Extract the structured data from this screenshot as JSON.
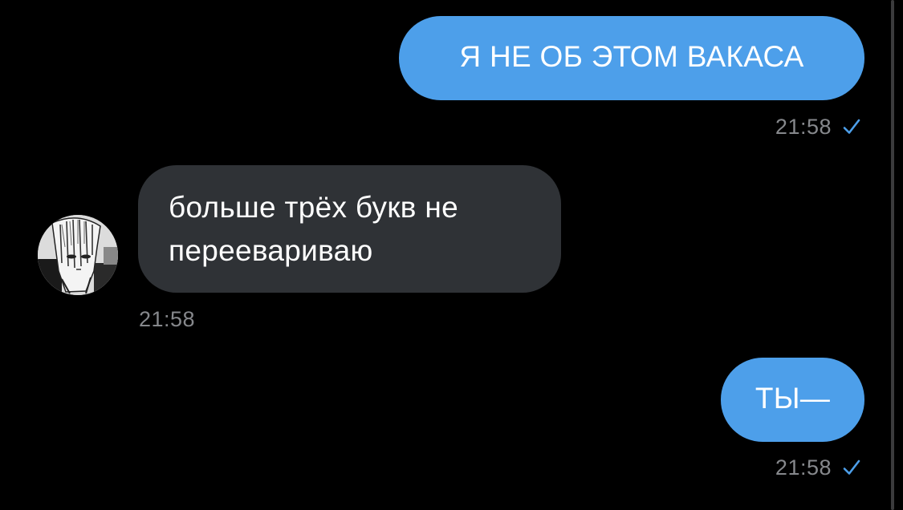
{
  "messages": [
    {
      "direction": "outgoing",
      "text": "Я НЕ ОБ ЭТОМ ВАКАСА",
      "time": "21:58",
      "status_icon": "single-check-icon"
    },
    {
      "direction": "incoming",
      "text": "больше трёх букв не\nпереевариваю",
      "time": "21:58",
      "avatar_icon": "avatar-manga-character"
    },
    {
      "direction": "outgoing",
      "text": "ТЫ—",
      "time": "21:58",
      "status_icon": "single-check-icon"
    }
  ],
  "colors": {
    "background": "#000000",
    "outgoing_bubble": "#4d9fea",
    "incoming_bubble": "#2f3236",
    "timestamp": "#86888c",
    "check": "#4d9fea"
  }
}
